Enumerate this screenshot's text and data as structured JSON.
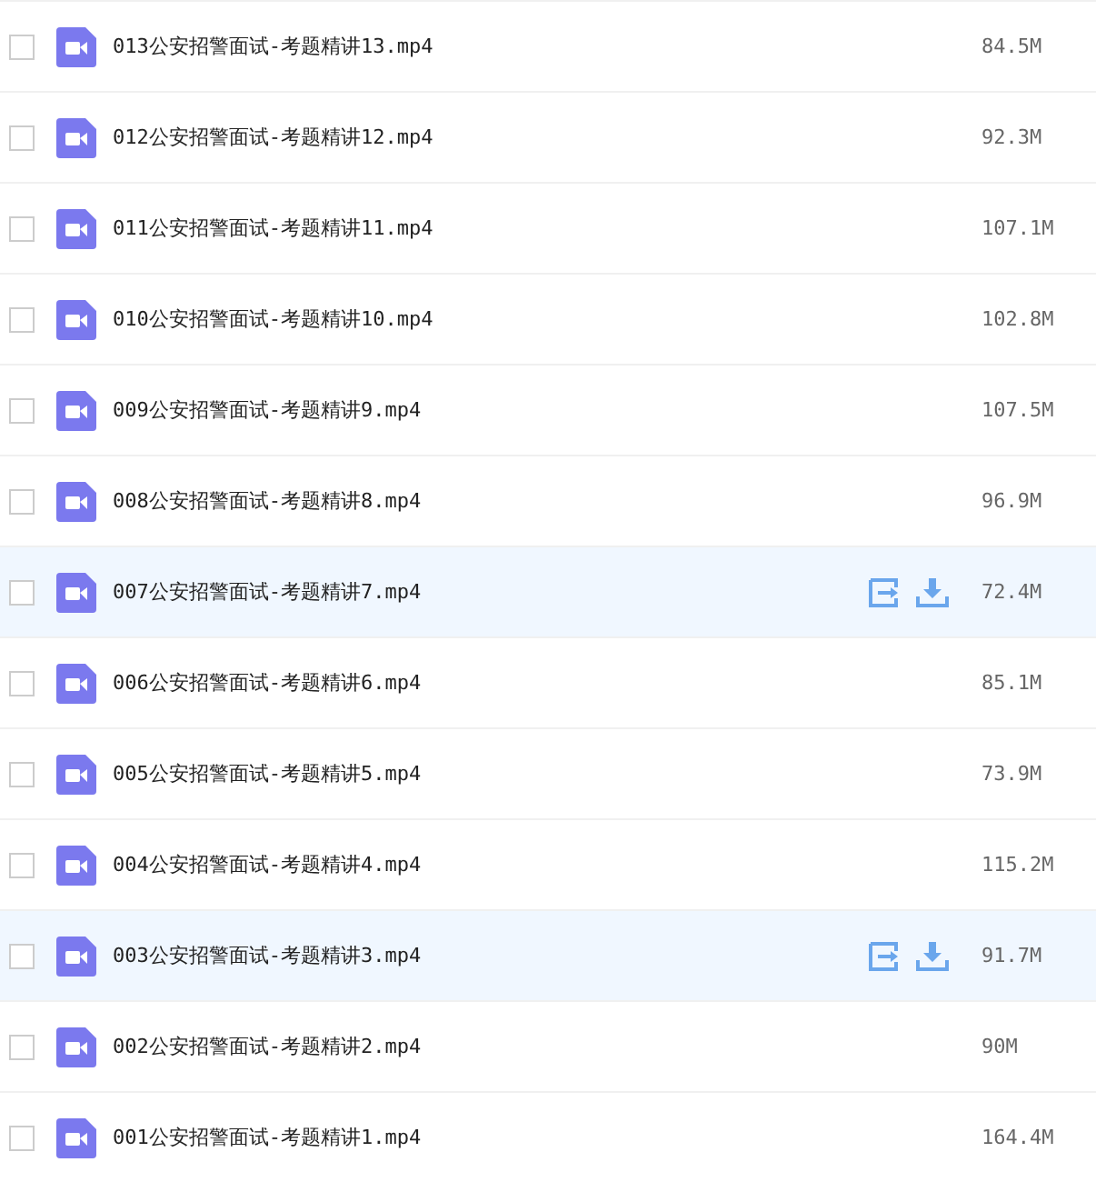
{
  "files": [
    {
      "name": "013公安招警面试-考题精讲13.mp4",
      "size": "84.5M",
      "hovered": false,
      "checked": false
    },
    {
      "name": "012公安招警面试-考题精讲12.mp4",
      "size": "92.3M",
      "hovered": false,
      "checked": false
    },
    {
      "name": "011公安招警面试-考题精讲11.mp4",
      "size": "107.1M",
      "hovered": false,
      "checked": false
    },
    {
      "name": "010公安招警面试-考题精讲10.mp4",
      "size": "102.8M",
      "hovered": false,
      "checked": false
    },
    {
      "name": "009公安招警面试-考题精讲9.mp4",
      "size": "107.5M",
      "hovered": false,
      "checked": false
    },
    {
      "name": "008公安招警面试-考题精讲8.mp4",
      "size": "96.9M",
      "hovered": false,
      "checked": false
    },
    {
      "name": "007公安招警面试-考题精讲7.mp4",
      "size": "72.4M",
      "hovered": true,
      "checked": false
    },
    {
      "name": "006公安招警面试-考题精讲6.mp4",
      "size": "85.1M",
      "hovered": false,
      "checked": false
    },
    {
      "name": "005公安招警面试-考题精讲5.mp4",
      "size": "73.9M",
      "hovered": false,
      "checked": false
    },
    {
      "name": "004公安招警面试-考题精讲4.mp4",
      "size": "115.2M",
      "hovered": false,
      "checked": false
    },
    {
      "name": "003公安招警面试-考题精讲3.mp4",
      "size": "91.7M",
      "hovered": true,
      "checked": false
    },
    {
      "name": "002公安招警面试-考题精讲2.mp4",
      "size": "90M",
      "hovered": false,
      "checked": false
    },
    {
      "name": "001公安招警面试-考题精讲1.mp4",
      "size": "164.4M",
      "hovered": false,
      "checked": false
    }
  ]
}
